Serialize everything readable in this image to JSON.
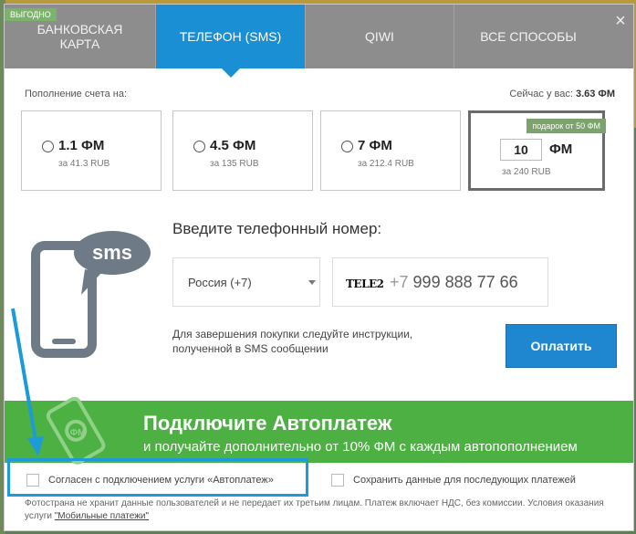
{
  "tabs": [
    {
      "label": "БАНКОВСКАЯ\nКАРТА",
      "badge": "ВЫГОДНО"
    },
    {
      "label": "ТЕЛЕФОН (SMS)"
    },
    {
      "label": "QIWI"
    },
    {
      "label": "ВСЕ СПОСОБЫ"
    }
  ],
  "close_label": "×",
  "topup_label": "Пополнение счета на:",
  "balance_label": "Сейчас у вас:",
  "balance_value": "3.63 ФМ",
  "options": [
    {
      "amount": "1.1 ФМ",
      "price": "за 41.3 RUB"
    },
    {
      "amount": "4.5 ФМ",
      "price": "за 135 RUB"
    },
    {
      "amount": "7 ФМ",
      "price": "за 212.4 RUB"
    }
  ],
  "custom": {
    "gift": "подарок от 50 ФМ",
    "value": "10",
    "unit": "ФМ",
    "price": "за 240 RUB"
  },
  "sms_label": "sms",
  "enter_title": "Введите телефонный номер:",
  "country": "Россия (+7)",
  "operator": "TELE2",
  "phone_prefix": "+7",
  "phone_number": "999 888 77 66",
  "instruction": "Для завершения покупки следуйте инструкции, полученной в SMS сообщении",
  "pay_button": "Оплатить",
  "banner_title": "Подключите Автоплатеж",
  "banner_sub": "и получайте дополнительно от 10% ФМ с каждым автопополнением",
  "agree_label": "Согласен с подключением услуги «Автоплатеж»",
  "save_label": "Сохранить данные для последующих платежей",
  "footer_text": "Фотострана не хранит данные пользователей и не передает их третьим лицам. Платеж включает НДС, без комиссии. Условия оказания услуги",
  "footer_link": "\"Мобильные платежи\"",
  "colors": {
    "accent": "#1a8fd3",
    "banner": "#4cb043",
    "gift": "#7ba36b"
  }
}
